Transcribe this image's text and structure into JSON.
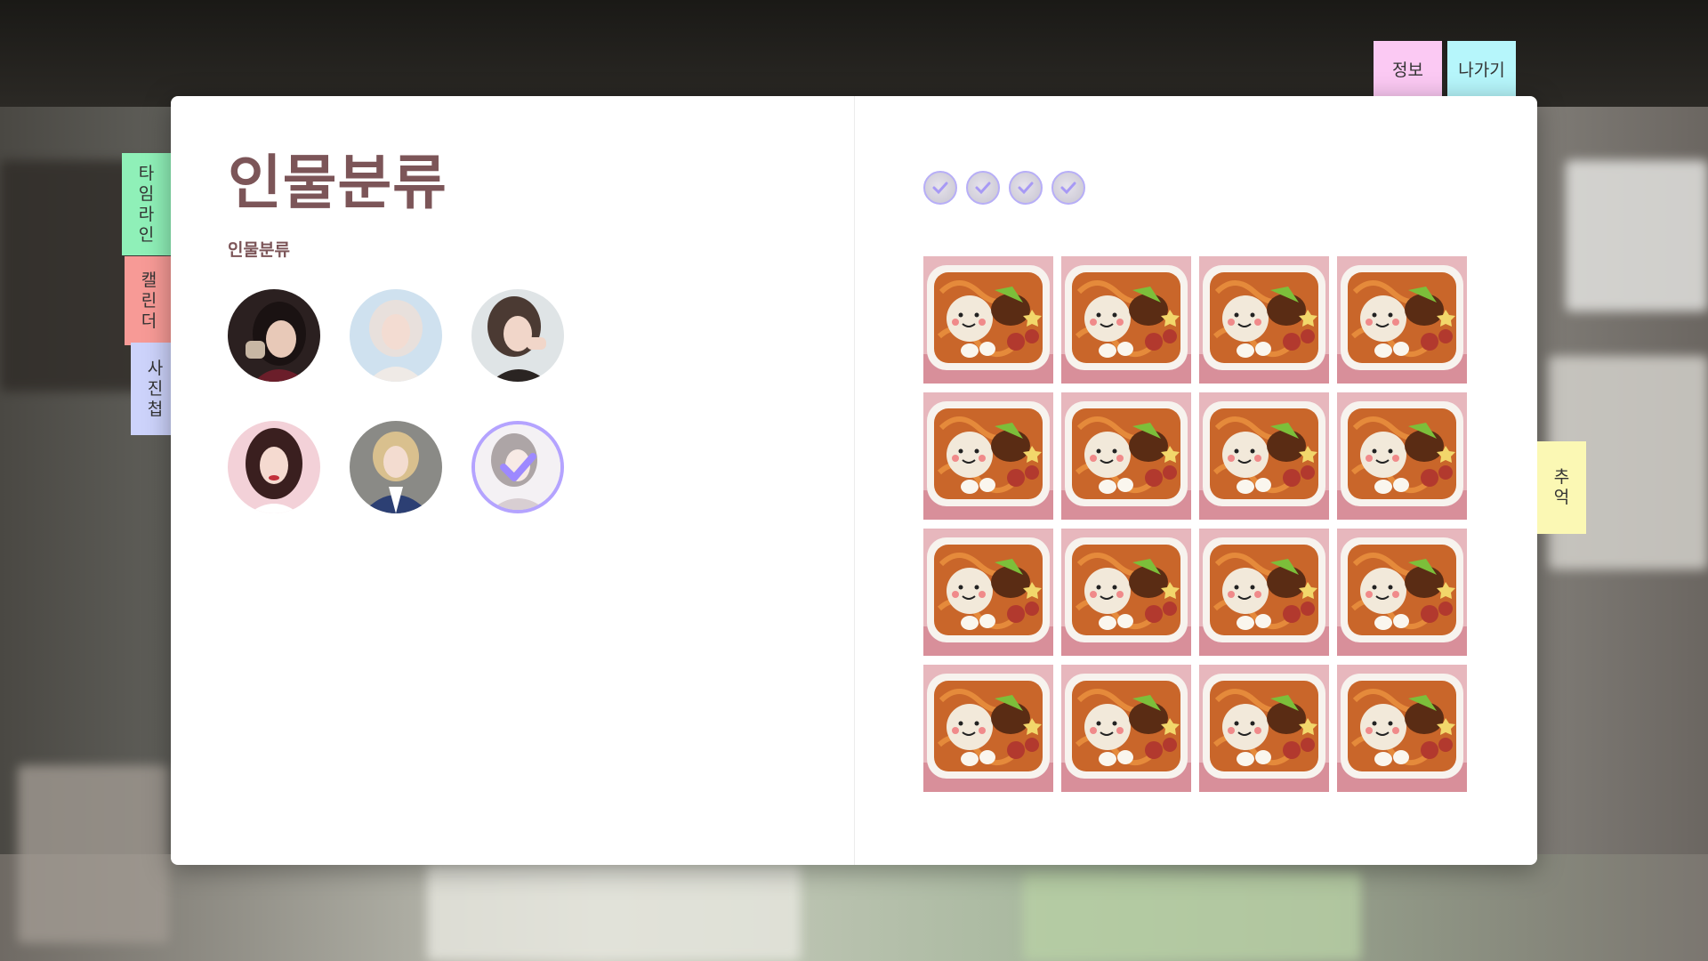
{
  "nav": {
    "side_tabs": [
      {
        "label": "타임라인",
        "chars": [
          "타",
          "임",
          "라",
          "인"
        ],
        "color": "#8ff0b8"
      },
      {
        "label": "캘린더",
        "chars": [
          "캘",
          "린",
          "더"
        ],
        "color": "#f79a96"
      },
      {
        "label": "사진첩",
        "chars": [
          "사",
          "진",
          "첩"
        ],
        "color": "#cdd3fb"
      }
    ],
    "top_tabs": {
      "info": {
        "label": "정보",
        "color": "#fbc9f3"
      },
      "exit": {
        "label": "나가기",
        "color": "#b6f6fb"
      }
    },
    "right_tab": {
      "label": "추억",
      "chars": [
        "추",
        "억"
      ],
      "color": "#fbf8b4"
    }
  },
  "left_page": {
    "title": "인물분류",
    "subtitle": "인물분류",
    "people": [
      {
        "name": "person-1",
        "selected": false
      },
      {
        "name": "person-2",
        "selected": false
      },
      {
        "name": "person-3",
        "selected": false
      },
      {
        "name": "person-4",
        "selected": false
      },
      {
        "name": "person-5",
        "selected": false
      },
      {
        "name": "person-6",
        "selected": true
      }
    ]
  },
  "right_page": {
    "filter_chips": 4,
    "photo_rows": 4,
    "photo_cols": 4,
    "photo_subject": "bento-lunchbox"
  },
  "colors": {
    "accent": "#b4a3ff",
    "title": "#7c5558",
    "page": "#ffffff"
  }
}
